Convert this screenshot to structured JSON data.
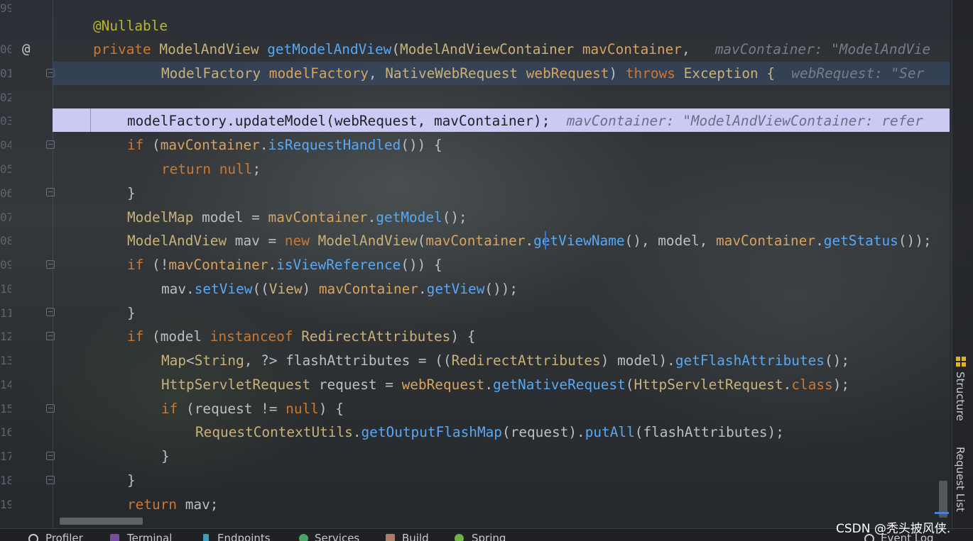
{
  "line_numbers": [
    "99",
    "00",
    "01",
    "02",
    "03",
    "04",
    "05",
    "06",
    "07",
    "08",
    "09",
    "10",
    "11",
    "12",
    "13",
    "14",
    "15",
    "16",
    "17",
    "18",
    "19"
  ],
  "gutter": {
    "override_marker": "@"
  },
  "code": {
    "l0_annotation": "@Nullable",
    "l1": {
      "private": "private",
      "type1": "ModelAndView",
      "method": "getModelAndView",
      "p1": "(",
      "type2": "ModelAndViewContainer",
      "param": "mavContainer",
      "p2": ",",
      "hint": "mavContainer: \"ModelAndVie"
    },
    "l2": {
      "type1": "ModelFactory",
      "param1": "modelFactory",
      "p1": ",",
      "type2": "NativeWebRequest",
      "param2": "webRequest",
      "p2": ")",
      "throws": "throws",
      "exc": "Exception {",
      "hint": "webRequest: \"Ser"
    },
    "l4": {
      "code": "modelFactory.updateModel(webRequest, mavContainer);",
      "hint": "mavContainer: \"ModelAndViewContainer: refer"
    },
    "l5": {
      "if": "if",
      "p1": "(",
      "var": "mavContainer",
      "dot": ".",
      "call": "isRequestHandled",
      "p2": "()) {"
    },
    "l6": {
      "return": "return",
      "null": "null",
      "semi": ";"
    },
    "l7": "}",
    "l8": {
      "type": "ModelMap",
      "mid": "model =",
      "var": "mavContainer",
      "dot": ".",
      "call": "getModel",
      "end": "();"
    },
    "l9": {
      "type": "ModelAndView",
      "mid": "mav =",
      "new": "new",
      "type2": "ModelAndView",
      "p1": "(",
      "var1": "mavContainer",
      "dot1": ".",
      "call1": "getViewName",
      "mid2": "(), model,",
      "var2": "mavContainer",
      "dot2": ".",
      "call2": "getStatus",
      "end": "());"
    },
    "l10": {
      "if": "if",
      "p1": "(!",
      "var": "mavContainer",
      "dot": ".",
      "call": "isViewReference",
      "end": "()) {"
    },
    "l11": {
      "pre": "mav.",
      "call": "setView",
      "p1": "((",
      "type": "View",
      "p2": ")",
      "var": "mavContainer",
      "dot": ".",
      "call2": "getView",
      "end": "());"
    },
    "l12": "}",
    "l13": {
      "if": "if",
      "p1": "(model",
      "instanceof": "instanceof",
      "type": "RedirectAttributes",
      "end": ") {"
    },
    "l14": {
      "type1": "Map",
      "p1": "<",
      "type2": "String",
      "mid": ", ?> flashAttributes = ((",
      "type3": "RedirectAttributes",
      "mid2": ") model).",
      "call": "getFlashAttributes",
      "end": "();"
    },
    "l15": {
      "type": "HttpServletRequest",
      "mid": "request =",
      "var": "webRequest",
      "dot": ".",
      "call": "getNativeRequest",
      "p1": "(",
      "type2": "HttpServletRequest",
      "dot2": ".",
      "class": "class",
      "end": ");"
    },
    "l16": {
      "if": "if",
      "p1": "(request !=",
      "null": "null",
      "end": ") {"
    },
    "l17": {
      "type": "RequestContextUtils",
      "dot": ".",
      "call": "getOutputFlashMap",
      "mid": "(request).",
      "call2": "putAll",
      "end": "(flashAttributes);"
    },
    "l18": "}",
    "l19": "}",
    "l20": {
      "return": "return",
      "end": "mav;"
    }
  },
  "side_tabs": {
    "structure": "Structure",
    "request_list": "Request List"
  },
  "statusbar": {
    "profiler": "Profiler",
    "terminal": "Terminal",
    "endpoints": "Endpoints",
    "services": "Services",
    "build": "Build",
    "spring": "Spring",
    "event_log": "Event Log"
  },
  "watermark": "CSDN @秃头披风侠.",
  "colors": {
    "keyword": "#cc7832",
    "type": "#c9b177",
    "method": "#57a8f5",
    "field": "#c77dbb",
    "param": "#d7a35f",
    "exec_line": "#c9cbf5",
    "selected_line": "#384e70"
  }
}
